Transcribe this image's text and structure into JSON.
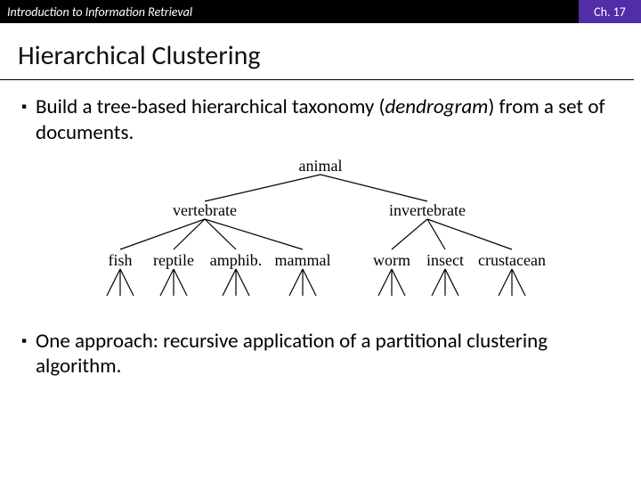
{
  "header": {
    "left": "Introduction to Information Retrieval",
    "right": "Ch. 17"
  },
  "title": "Hierarchical Clustering",
  "bullets": {
    "b1_pre": "Build a tree-based hierarchical taxonomy (",
    "b1_em": "dendrogram",
    "b1_post": ") from a set of documents.",
    "b2": "One approach: recursive application of a partitional clustering algorithm."
  },
  "tree": {
    "root": "animal",
    "left": "vertebrate",
    "right": "invertebrate",
    "l1": "fish",
    "l2": "reptile",
    "l3": "amphib.",
    "l4": "mammal",
    "r1": "worm",
    "r2": "insect",
    "r3": "crustacean"
  }
}
